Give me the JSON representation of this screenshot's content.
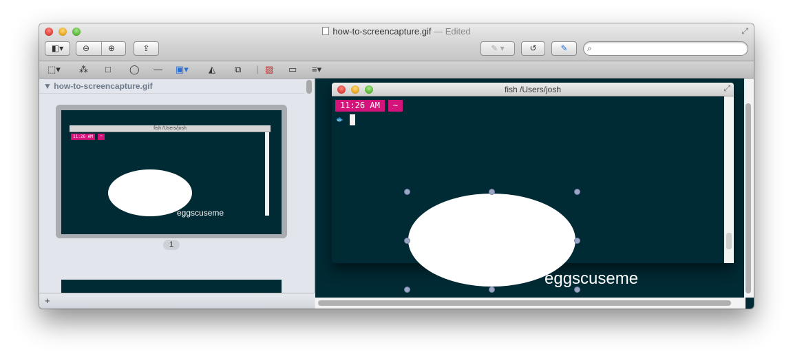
{
  "window": {
    "file_name": "how-to-screencapture.gif",
    "status": "— Edited"
  },
  "toolbar": {
    "sidebar_toggle_icon": "sidebar-icon",
    "zoom_out_icon": "zoom-out-icon",
    "zoom_in_icon": "zoom-in-icon",
    "share_icon": "share-icon",
    "highlight_icon": "pencil-icon",
    "rotate_icon": "rotate-icon",
    "markup_icon": "markup-pen-icon",
    "search_placeholder": ""
  },
  "annotation_tools": [
    "rect-select-icon",
    "instant-alpha-icon",
    "rectangle-icon",
    "oval-icon",
    "line-icon",
    "text-icon",
    "adjust-color-icon",
    "resize-icon",
    "sign-icon",
    "note-icon",
    "line-style-icon"
  ],
  "sidebar": {
    "header": "how-to-screencapture.gif",
    "page_number": "1"
  },
  "terminal": {
    "title": "fish  /Users/josh",
    "time": "11:26 AM",
    "dir": "~",
    "text": "eggscuseme"
  },
  "colors": {
    "terminal_bg": "#002a34",
    "prompt_badge": "#d4147a",
    "handle": "#9aa6c4"
  }
}
